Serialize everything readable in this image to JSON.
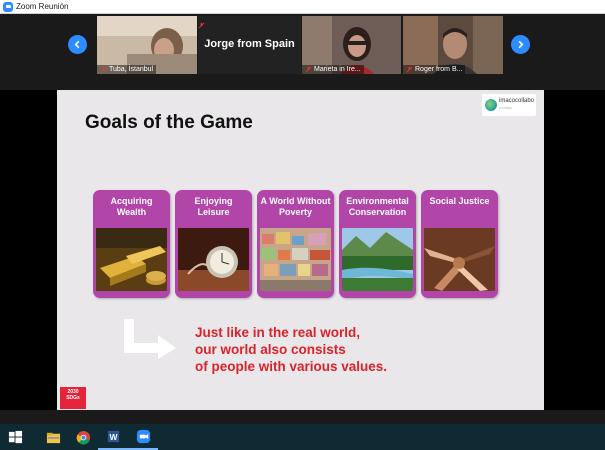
{
  "window": {
    "title": "Zoom Reunión"
  },
  "participants": [
    {
      "name": "Tuba, İstanbul"
    },
    {
      "name": "Jorge from Spain"
    },
    {
      "name": "Marieta in Ire..."
    },
    {
      "name": "Roger from B..."
    }
  ],
  "slide": {
    "title": "Goals of the Game",
    "brand": {
      "name": "imacocollabo",
      "sub": "z-YOSKA"
    },
    "cards": [
      {
        "label": "Acquiring Wealth"
      },
      {
        "label": "Enjoying Leisure"
      },
      {
        "label": "A World Without Poverty"
      },
      {
        "label": "Environmental Conservation"
      },
      {
        "label": "Social Justice"
      }
    ],
    "message_lines": [
      "Just like in the real world,",
      "our world also consists",
      "of people with various values."
    ],
    "sdg_badge": "2030 SDGs"
  },
  "colors": {
    "accent": "#2d8cff",
    "card": "#b245a8",
    "message": "#d8232a"
  },
  "taskbar": {
    "icons": [
      "windows-icon",
      "file-explorer-icon",
      "chrome-icon",
      "word-icon",
      "zoom-icon"
    ]
  }
}
